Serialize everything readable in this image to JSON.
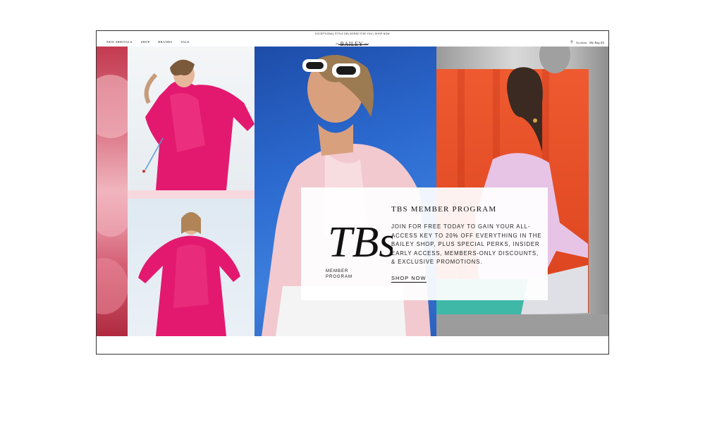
{
  "announcement": "EXCEPTIONAL STYLE DELIVERED FOR YOU | SHOP NOW",
  "nav": {
    "items": [
      "NEW ARRIVALS",
      "SHOP",
      "BRANDS",
      "SALE"
    ]
  },
  "logo": {
    "prefix": "the",
    "name": "BAILEY",
    "suffix": "shop"
  },
  "account": {
    "account_label": "Account",
    "bag_label": "My Bag",
    "bag_count": "0"
  },
  "promo": {
    "monogram_main": "TBs",
    "monogram_sub_1": "MEMBER",
    "monogram_sub_2": "PROGRAM",
    "title": "TBS MEMBER PROGRAM",
    "body": "JOIN FOR FREE TODAY TO GAIN YOUR ALL-ACCESS KEY TO 20% OFF EVERYTHING IN THE BAILEY SHOP, PLUS SPECIAL PERKS, INSIDER EARLY ACCESS, MEMBERS-ONLY DISCOUNTS, & EXCLUSIVE PROMOTIONS.",
    "cta": "SHOP NOW"
  },
  "colors": {
    "pink_dress": "#e3196f",
    "sky_blue": "#2c6ad0",
    "orange_bg": "#e34c25",
    "lavender_dress": "#e7c4e6"
  }
}
